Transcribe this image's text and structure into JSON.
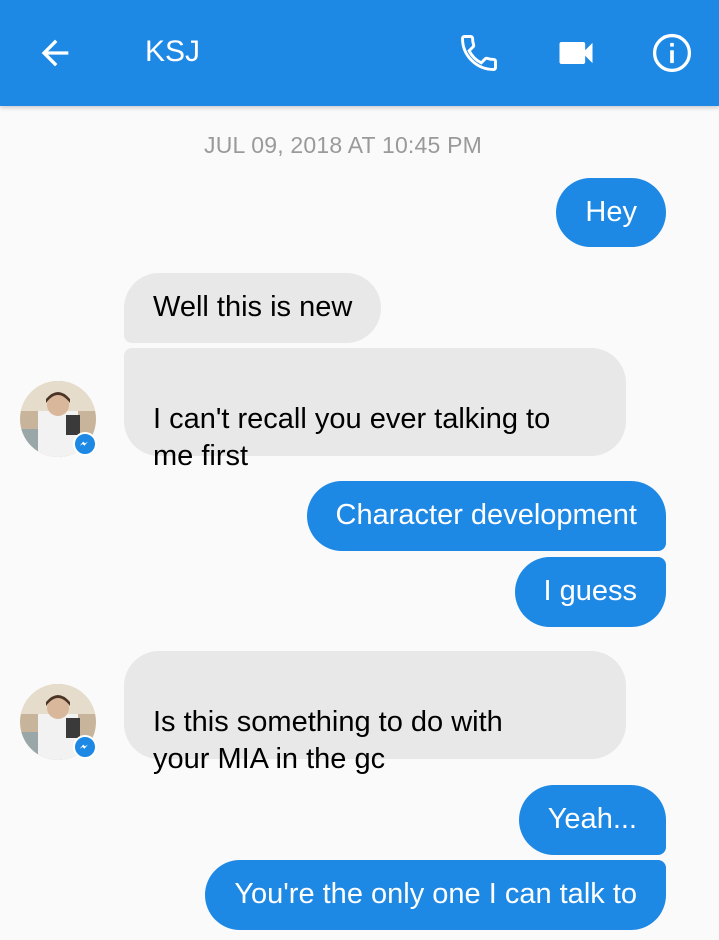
{
  "header": {
    "title": "KSJ",
    "back_icon": "arrow-left-icon",
    "call_icon": "phone-icon",
    "video_icon": "video-camera-icon",
    "info_icon": "info-icon",
    "accent_color": "#1e88e5"
  },
  "conversation": {
    "timestamp": "JUL 09, 2018 AT 10:45 PM",
    "messages": [
      {
        "from": "me",
        "text": "Hey"
      },
      {
        "from": "them",
        "text": "Well this is new"
      },
      {
        "from": "them",
        "text": "I can't recall you ever talking to\nme first"
      },
      {
        "from": "me",
        "text": "Character development"
      },
      {
        "from": "me",
        "text": "I guess"
      },
      {
        "from": "them",
        "text": "Is this something to do with\nyour MIA in the gc"
      },
      {
        "from": "me",
        "text": "Yeah..."
      },
      {
        "from": "me",
        "text": "You're the only one I can talk to"
      }
    ]
  },
  "colors": {
    "sent_bubble": "#1e88e5",
    "received_bubble": "#e8e8e8",
    "background": "#fafafa",
    "timestamp_text": "#9a9a9a"
  }
}
